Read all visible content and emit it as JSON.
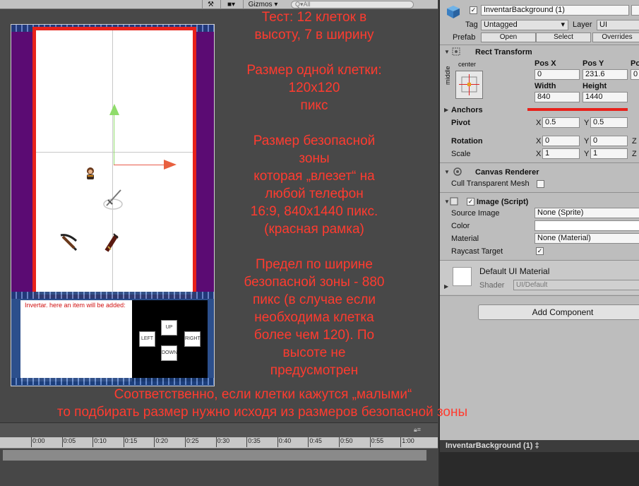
{
  "toolbar": {
    "gizmos_label": "Gizmos",
    "search_placeholder": "Q▾All"
  },
  "scene": {
    "inventory_text": "Invertar. here an item will be added:",
    "dpad": {
      "up": "UP",
      "down": "DOWN",
      "left": "LEFT",
      "right": "RIGHT"
    }
  },
  "annotation": {
    "lines_block1": [
      "Тест: 12 клеток в",
      "высоту, 7 в ширину"
    ],
    "lines_block2": [
      "Размер одной клетки:",
      "120x120",
      "пикс"
    ],
    "lines_block3": [
      "Размер безопасной",
      "зоны",
      "которая „влезет“ на",
      "любой телефон",
      "16:9, 840x1440 пикс.",
      "(красная рамка)"
    ],
    "lines_block4": [
      "Предел по ширине",
      "безопасной зоны - 880",
      "пикс (в случае если",
      "необходима клетка",
      "более чем 120). По",
      "высоте не",
      "предусмотрен"
    ],
    "line_bottom1": "Соответственно, если клетки кажутся „малыми“",
    "line_bottom2": "то подбирать размер нужно исходя из размеров безопасной зоны"
  },
  "timeline": {
    "ticks": [
      "0:00",
      "0:05",
      "0:10",
      "0:15",
      "0:20",
      "0:25",
      "0:30",
      "0:35",
      "0:40",
      "0:45",
      "0:50",
      "0:55",
      "1:00"
    ]
  },
  "inspector": {
    "object_name": "InventarBackground (1)",
    "tag_label": "Tag",
    "tag_value": "Untagged",
    "layer_label": "Layer",
    "layer_value": "UI",
    "prefab_label": "Prefab",
    "prefab_open": "Open",
    "prefab_select": "Select",
    "prefab_overrides": "Overrides",
    "rect_transform": {
      "title": "Rect Transform",
      "anchor_h": "center",
      "anchor_v": "middle",
      "pos_x_label": "Pos X",
      "pos_y_label": "Pos Y",
      "pos_z_label": "Po",
      "pos_x": "0",
      "pos_y": "231.6",
      "pos_z": "0",
      "width_label": "Width",
      "height_label": "Height",
      "width": "840",
      "height": "1440",
      "anchors_label": "Anchors",
      "pivot_label": "Pivot",
      "pivot_x": "0.5",
      "pivot_y": "0.5",
      "rotation_label": "Rotation",
      "rot_x": "0",
      "rot_y": "0",
      "scale_label": "Scale",
      "scale_x": "1",
      "scale_y": "1",
      "x": "X",
      "y": "Y",
      "z": "Z"
    },
    "canvas_renderer": {
      "title": "Canvas Renderer",
      "cull_label": "Cull Transparent Mesh"
    },
    "image": {
      "title": "Image (Script)",
      "source_label": "Source Image",
      "source_value": "None (Sprite)",
      "color_label": "Color",
      "material_label": "Material",
      "material_value": "None (Material)",
      "raycast_label": "Raycast Target"
    },
    "material_preview": {
      "title": "Default UI Material",
      "shader_label": "Shader",
      "shader_value": "UI/Default"
    },
    "add_component": "Add Component",
    "bottom_tab": "InventarBackground (1) ‡"
  },
  "colors": {
    "annotation_red": "#ff3b2f",
    "safe_zone_border": "#e8221b",
    "canvas_purple": "#5b0b73"
  }
}
